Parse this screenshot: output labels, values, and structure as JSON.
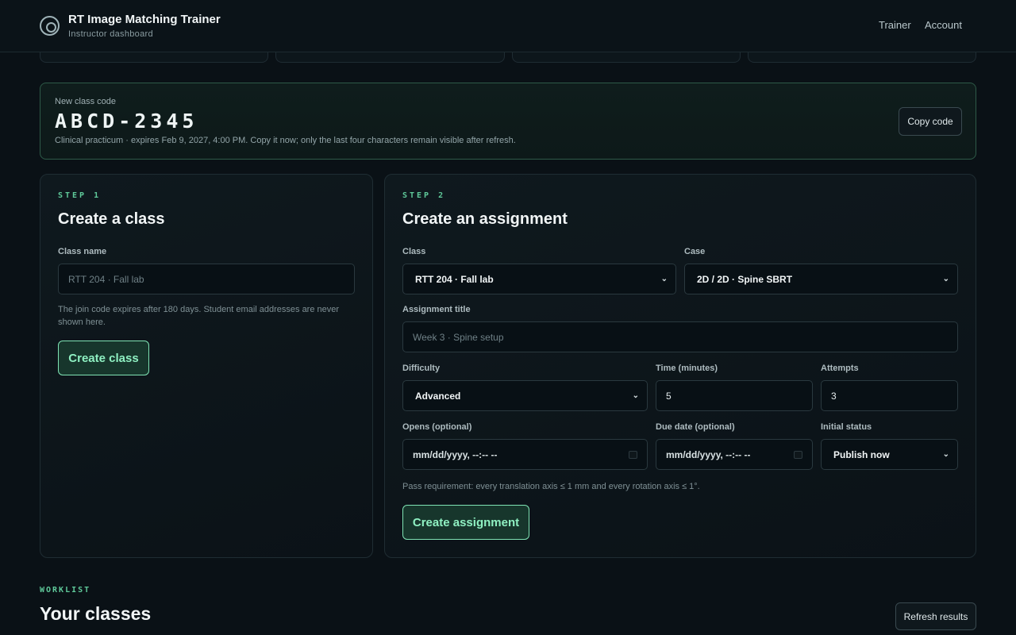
{
  "header": {
    "title": "RT Image Matching Trainer",
    "subtitle": "Instructor dashboard",
    "nav": {
      "trainer": "Trainer",
      "account": "Account"
    }
  },
  "class_code": {
    "label": "New class code",
    "code": "ABCD-2345",
    "meta": "Clinical practicum · expires Feb 9, 2027, 4:00 PM. Copy it now; only the last four characters remain visible after refresh.",
    "copy_label": "Copy code"
  },
  "create_class": {
    "step": "STEP 1",
    "title": "Create a class",
    "name_label": "Class name",
    "name_placeholder": "RTT 204 · Fall lab",
    "hint": "The join code expires after 180 days. Student email addresses are never shown here.",
    "button": "Create class"
  },
  "create_assignment": {
    "step": "STEP 2",
    "title": "Create an assignment",
    "class_label": "Class",
    "class_value": "RTT 204 · Fall lab",
    "case_label": "Case",
    "case_value": "2D / 2D · Spine SBRT",
    "title_label": "Assignment title",
    "title_placeholder": "Week 3 · Spine setup",
    "difficulty_label": "Difficulty",
    "difficulty_value": "Advanced",
    "time_label": "Time (minutes)",
    "time_value": "5",
    "attempts_label": "Attempts",
    "attempts_value": "3",
    "opens_label": "Opens (optional)",
    "opens_value": "mm/dd/yyyy, --:-- --",
    "due_label": "Due date (optional)",
    "due_value": "mm/dd/yyyy, --:-- --",
    "status_label": "Initial status",
    "status_value": "Publish now",
    "pass_hint": "Pass requirement: every translation axis ≤ 1 mm and every rotation axis ≤ 1°.",
    "button": "Create assignment"
  },
  "worklist": {
    "tag": "WORKLIST",
    "title": "Your classes",
    "refresh_label": "Refresh results"
  },
  "icons": {
    "logo": "target-icon",
    "select": "chevron-down-icon",
    "calendar": "calendar-icon"
  },
  "colors": {
    "accent": "#5fc99a",
    "background": "#0a1116",
    "button_fill": "#17362c"
  }
}
